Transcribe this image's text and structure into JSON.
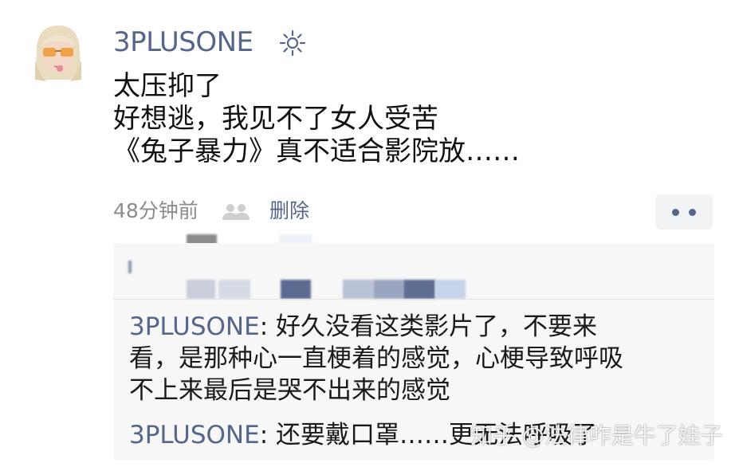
{
  "post": {
    "username": "3PLUSONE",
    "username_badge_icon": "sun-icon",
    "lines": [
      "太压抑了",
      "好想逃，我见不了女人受苦",
      "《兔子暴力》真不适合影院放……"
    ],
    "time": "48分钟前",
    "delete_label": "删除",
    "more_icon": "more-dots-icon"
  },
  "comments": [
    {
      "author": "3PLUSONE",
      "separator": ": ",
      "lines": [
        "好久没看这类影片了，不要来",
        "看，是那种心一直梗着的感觉，心梗导致呼吸",
        "不上来最后是哭不出来的感觉"
      ]
    },
    {
      "author": "3PLUSONE",
      "separator": ": ",
      "text": "还要戴口罩……更无法呼吸了"
    }
  ],
  "watermark": "知乎 @法律咋是牛了娃子",
  "colors": {
    "link": "#55668a",
    "panel_bg": "#f7f7f7",
    "text": "#1a1a1a",
    "muted": "#8c8c8c"
  }
}
